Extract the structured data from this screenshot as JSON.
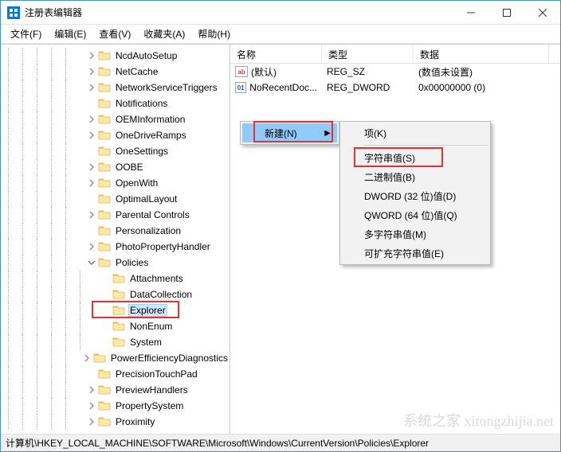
{
  "window": {
    "title": "注册表编辑器"
  },
  "menubar": {
    "file": "文件(F)",
    "edit": "编辑(E)",
    "view": "查看(V)",
    "favorites": "收藏夹(A)",
    "help": "帮助(H)"
  },
  "tree": {
    "items": [
      {
        "indent": 6,
        "expand": "closed",
        "label": "NcdAutoSetup"
      },
      {
        "indent": 6,
        "expand": "closed",
        "label": "NetCache"
      },
      {
        "indent": 6,
        "expand": "closed",
        "label": "NetworkServiceTriggers"
      },
      {
        "indent": 6,
        "expand": "none",
        "label": "Notifications"
      },
      {
        "indent": 6,
        "expand": "closed",
        "label": "OEMInformation"
      },
      {
        "indent": 6,
        "expand": "closed",
        "label": "OneDriveRamps"
      },
      {
        "indent": 6,
        "expand": "none",
        "label": "OneSettings"
      },
      {
        "indent": 6,
        "expand": "closed",
        "label": "OOBE"
      },
      {
        "indent": 6,
        "expand": "closed",
        "label": "OpenWith"
      },
      {
        "indent": 6,
        "expand": "none",
        "label": "OptimalLayout"
      },
      {
        "indent": 6,
        "expand": "closed",
        "label": "Parental Controls"
      },
      {
        "indent": 6,
        "expand": "none",
        "label": "Personalization"
      },
      {
        "indent": 6,
        "expand": "closed",
        "label": "PhotoPropertyHandler"
      },
      {
        "indent": 6,
        "expand": "open",
        "label": "Policies"
      },
      {
        "indent": 7,
        "expand": "none",
        "label": "Attachments"
      },
      {
        "indent": 7,
        "expand": "none",
        "label": "DataCollection"
      },
      {
        "indent": 7,
        "expand": "none",
        "label": "Explorer",
        "selected": true,
        "highlight": true
      },
      {
        "indent": 7,
        "expand": "none",
        "label": "NonEnum"
      },
      {
        "indent": 7,
        "expand": "none",
        "label": "System"
      },
      {
        "indent": 6,
        "expand": "closed",
        "label": "PowerEfficiencyDiagnostics"
      },
      {
        "indent": 6,
        "expand": "none",
        "label": "PrecisionTouchPad"
      },
      {
        "indent": 6,
        "expand": "closed",
        "label": "PreviewHandlers"
      },
      {
        "indent": 6,
        "expand": "closed",
        "label": "PropertySystem"
      },
      {
        "indent": 6,
        "expand": "closed",
        "label": "Proximity"
      }
    ]
  },
  "list": {
    "columns": {
      "name": "名称",
      "type": "类型",
      "data": "数据"
    },
    "colwidths": {
      "name": 115,
      "type": 115,
      "data": 170
    },
    "rows": [
      {
        "icon": "ab",
        "name": "(默认)",
        "type": "REG_SZ",
        "data": "(数值未设置)"
      },
      {
        "icon": "bin",
        "name": "NoRecentDoc...",
        "type": "REG_DWORD",
        "data": "0x00000000 (0)"
      }
    ]
  },
  "ctx1": {
    "new": "新建(N)"
  },
  "ctx2": {
    "key": "项(K)",
    "string": "字符串值(S)",
    "binary": "二进制值(B)",
    "dword": "DWORD (32 位)值(D)",
    "qword": "QWORD (64 位)值(Q)",
    "multi": "多字符串值(M)",
    "expand": "可扩充字符串值(E)"
  },
  "statusbar": {
    "path": "计算机\\HKEY_LOCAL_MACHINE\\SOFTWARE\\Microsoft\\Windows\\CurrentVersion\\Policies\\Explorer"
  },
  "watermark": "系统之家 xitongzhijia.net"
}
